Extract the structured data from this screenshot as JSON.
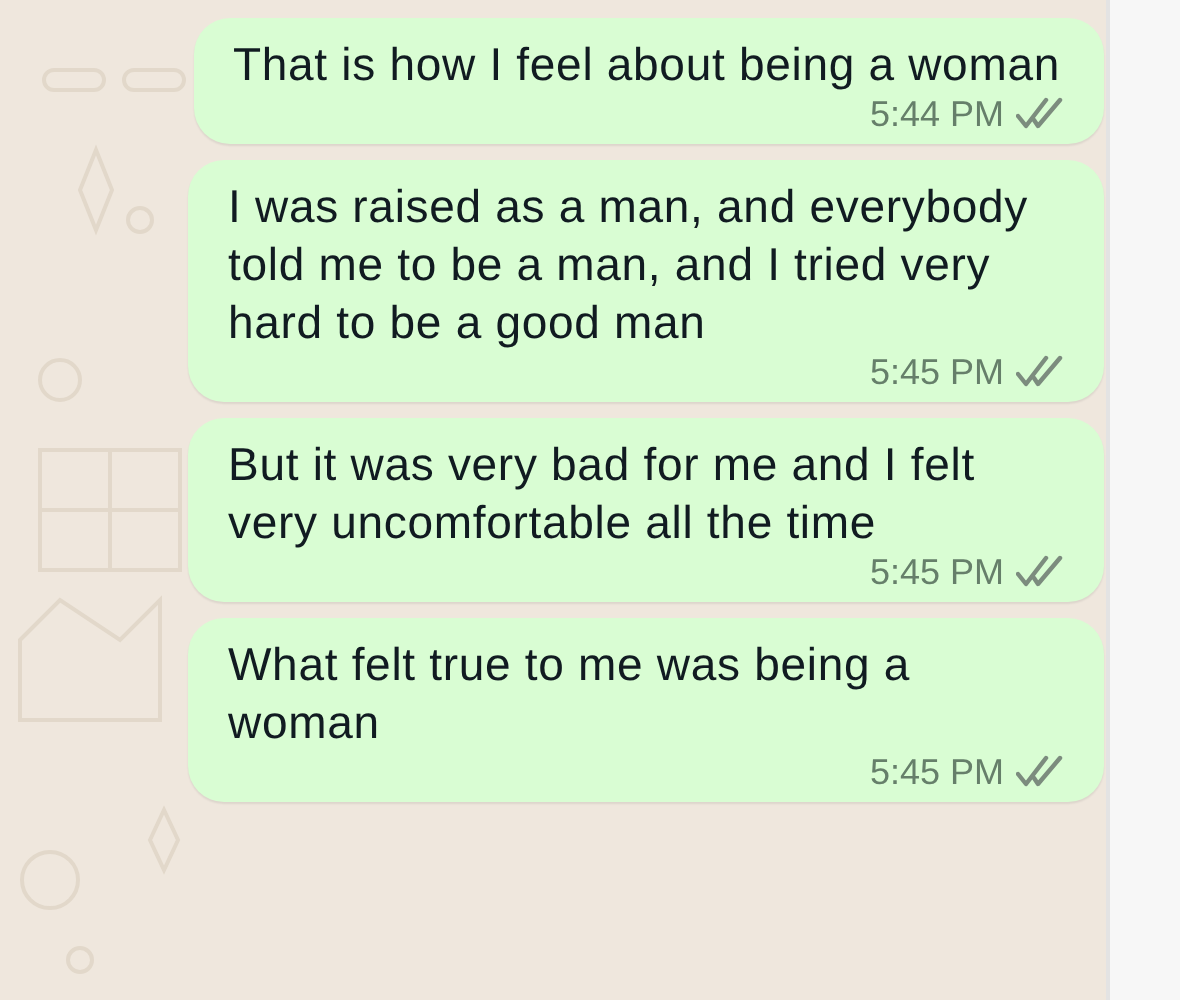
{
  "messages": [
    {
      "text": "That is how I feel about being a woman",
      "time": "5:44 PM",
      "read": false
    },
    {
      "text": "I was raised as a man, and everybody told me to be a man, and I tried very hard to be a good man",
      "time": "5:45 PM",
      "read": false
    },
    {
      "text": "But it was very bad for me and I felt very uncomfortable all the time",
      "time": "5:45 PM",
      "read": false
    },
    {
      "text": "What felt true to me was being a woman",
      "time": "5:45 PM",
      "read": false
    }
  ]
}
